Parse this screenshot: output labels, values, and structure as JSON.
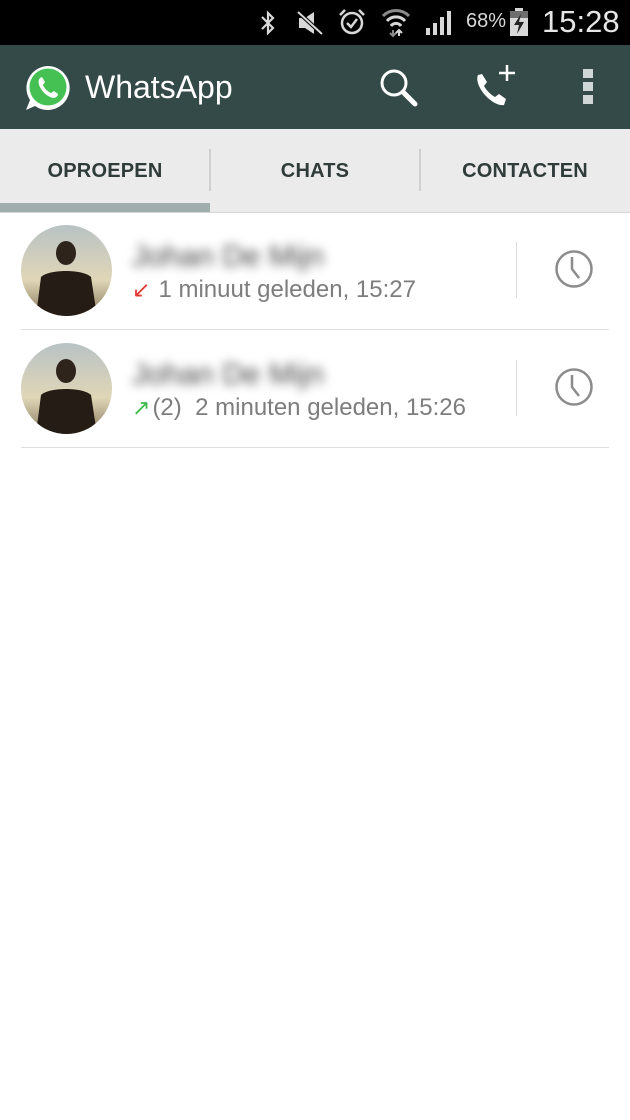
{
  "status_bar": {
    "icons": [
      "bluetooth-icon",
      "mute-icon",
      "alarm-icon",
      "wifi-icon",
      "signal-icon",
      "battery-charging-icon"
    ],
    "battery_percent": "68%",
    "time": "15:28"
  },
  "app_bar": {
    "title": "WhatsApp",
    "actions": [
      "search-icon",
      "new-call-icon",
      "overflow-menu-icon"
    ]
  },
  "tabs": [
    {
      "label": "OPROEPEN",
      "active": true
    },
    {
      "label": "CHATS",
      "active": false
    },
    {
      "label": "CONTACTEN",
      "active": false
    }
  ],
  "calls": [
    {
      "name": "Johan De Mijn",
      "direction": "incoming-missed",
      "arrow": "↙",
      "arrow_color": "#e53935",
      "count": "",
      "time_text": "1 minuut geleden, 15:27"
    },
    {
      "name": "Johan De Mijn",
      "direction": "outgoing",
      "arrow": "↗",
      "arrow_color": "#3dba4e",
      "count": "(2)",
      "time_text": "2 minuten geleden, 15:26"
    }
  ],
  "colors": {
    "app_bar": "#344a48",
    "whatsapp_green": "#45c153",
    "tab_indicator": "#9fadad"
  }
}
